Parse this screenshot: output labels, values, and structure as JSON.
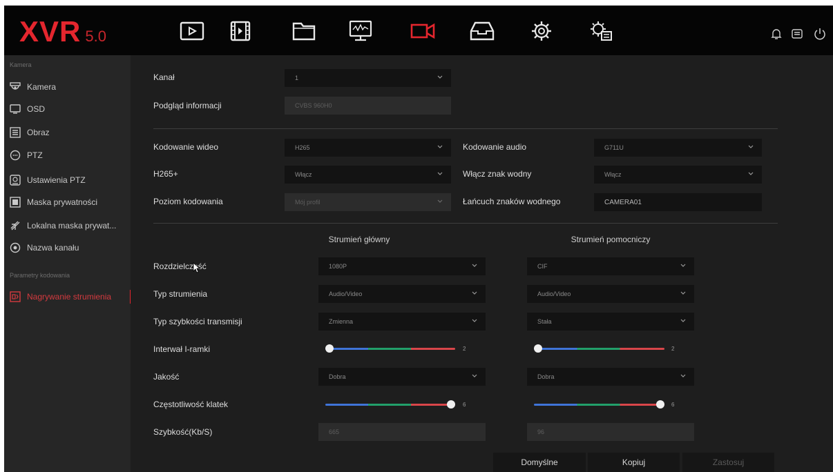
{
  "app": {
    "logo_text": "XVR",
    "version": "5.0"
  },
  "toolbar": {
    "icons": [
      "playback-icon",
      "video-list-icon",
      "folder-icon",
      "monitor-icon",
      "camera-icon",
      "storage-icon",
      "settings-icon",
      "system-settings-icon"
    ],
    "active": "camera-icon",
    "right_icons": [
      "bell-icon",
      "backup-icon",
      "power-icon"
    ]
  },
  "sidebar": {
    "section1": "Kamera",
    "items": [
      {
        "label": "Kamera",
        "icon": "camera-dome-icon"
      },
      {
        "label": "OSD",
        "icon": "osd-monitor-icon"
      },
      {
        "label": "Obraz",
        "icon": "image-adjust-icon"
      },
      {
        "label": "PTZ",
        "icon": "ptz-icon"
      },
      {
        "label": "Ustawienia PTZ",
        "icon": "ptz-settings-icon"
      },
      {
        "label": "Maska prywatności",
        "icon": "privacy-mask-icon"
      },
      {
        "label": "Lokalna maska prywat...",
        "icon": "local-mask-icon"
      },
      {
        "label": "Nazwa kanału",
        "icon": "eye-icon"
      }
    ],
    "section2": "Parametry kodowania",
    "active_item": {
      "label": "Nagrywanie strumienia",
      "icon": "record-stream-icon"
    }
  },
  "form": {
    "kanal": {
      "label": "Kanał",
      "value": "1"
    },
    "podglad": {
      "label": "Podgląd informacji",
      "value": "CVBS 960H0"
    },
    "kod_wideo": {
      "label": "Kodowanie wideo",
      "value": "H265"
    },
    "kod_audio": {
      "label": "Kodowanie audio",
      "value": "G711U"
    },
    "h265plus": {
      "label": "H265+",
      "value": "Włącz"
    },
    "znak_wodny": {
      "label": "Włącz znak wodny",
      "value": "Włącz"
    },
    "poziom": {
      "label": "Poziom kodowania",
      "value": "Mój profil"
    },
    "lancuch": {
      "label": "Łańcuch znaków wodnego",
      "value": "CAMERA01"
    }
  },
  "streams": {
    "main_header": "Strumień główny",
    "sub_header": "Strumień pomocniczy",
    "rows": {
      "rozdzielczosc": {
        "label": "Rozdzielczość",
        "main": "1080P",
        "sub": "CIF"
      },
      "typ": {
        "label": "Typ strumienia",
        "main": "Audio/Video",
        "sub": "Audio/Video"
      },
      "szybkosc_typ": {
        "label": "Typ szybkości transmisji",
        "main": "Zmienna",
        "sub": "Stała"
      },
      "interwal": {
        "label": "Interwał I-ramki",
        "main": "2",
        "sub": "2"
      },
      "jakosc": {
        "label": "Jakość",
        "main": "Dobra",
        "sub": "Dobra"
      },
      "klatki": {
        "label": "Częstotliwość klatek",
        "main": "6",
        "sub": "6"
      },
      "kbps": {
        "label": "Szybkość(Kb/S)",
        "main": "665",
        "sub": "96"
      }
    },
    "interwal_level_main": 0.0,
    "interwal_level_sub": 0.0,
    "klatki_level_main": 1.0,
    "klatki_level_sub": 1.0
  },
  "buttons": {
    "default": "Domyślne",
    "copy": "Kopiuj",
    "apply": "Zastosuj"
  },
  "colors": {
    "accent": "#e4262e",
    "panel": "#1e1e1e",
    "sidebar": "#262626"
  }
}
